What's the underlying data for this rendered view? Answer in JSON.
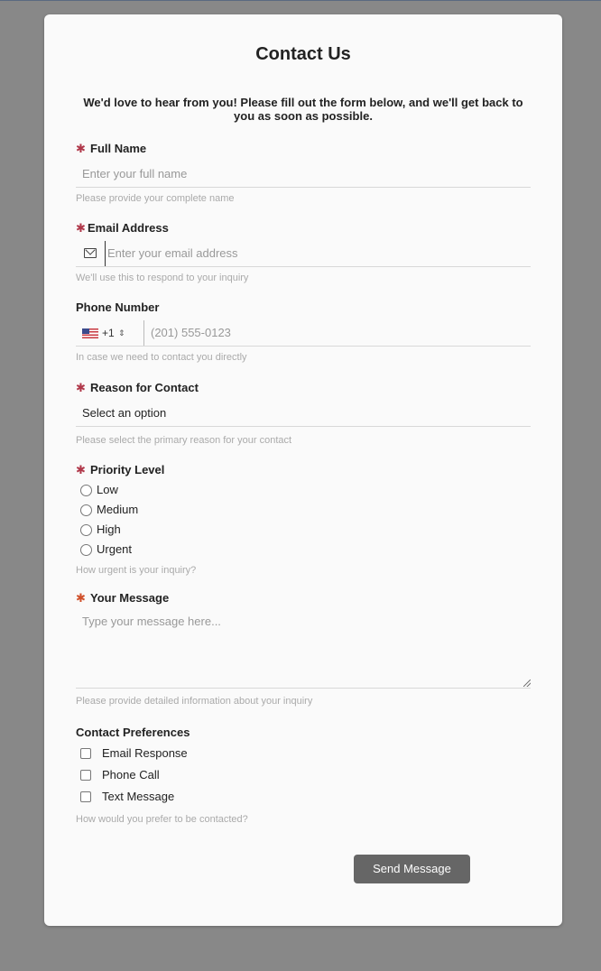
{
  "form": {
    "title": "Contact Us",
    "intro": "We'd love to hear from you! Please fill out the form below, and we'll get back to you as soon as possible.",
    "required_marker": "✱",
    "full_name": {
      "label": "Full Name",
      "placeholder": "Enter your full name",
      "help": "Please provide your complete name"
    },
    "email": {
      "label": "Email Address",
      "icon": "mail-icon",
      "placeholder": "Enter your email address",
      "help": "We'll use this to respond to your inquiry"
    },
    "phone": {
      "label": "Phone Number",
      "country_flag": "us-flag-icon",
      "country_code": "+1",
      "placeholder": "(201) 555-0123",
      "help": "In case we need to contact you directly"
    },
    "reason": {
      "label": "Reason for Contact",
      "selected": "Select an option",
      "help": "Please select the primary reason for your contact"
    },
    "priority": {
      "label": "Priority Level",
      "options": [
        "Low",
        "Medium",
        "High",
        "Urgent"
      ],
      "help": "How urgent is your inquiry?"
    },
    "message": {
      "label": "Your Message",
      "placeholder": "Type your message here...",
      "help": "Please provide detailed information about your inquiry"
    },
    "preferences": {
      "label": "Contact Preferences",
      "options": [
        "Email Response",
        "Phone Call",
        "Text Message"
      ],
      "help": "How would you prefer to be contacted?"
    },
    "submit_label": "Send Message"
  },
  "colors": {
    "background": "#888888",
    "card": "#fafafa",
    "button": "#666666",
    "required": "#b0384a"
  }
}
